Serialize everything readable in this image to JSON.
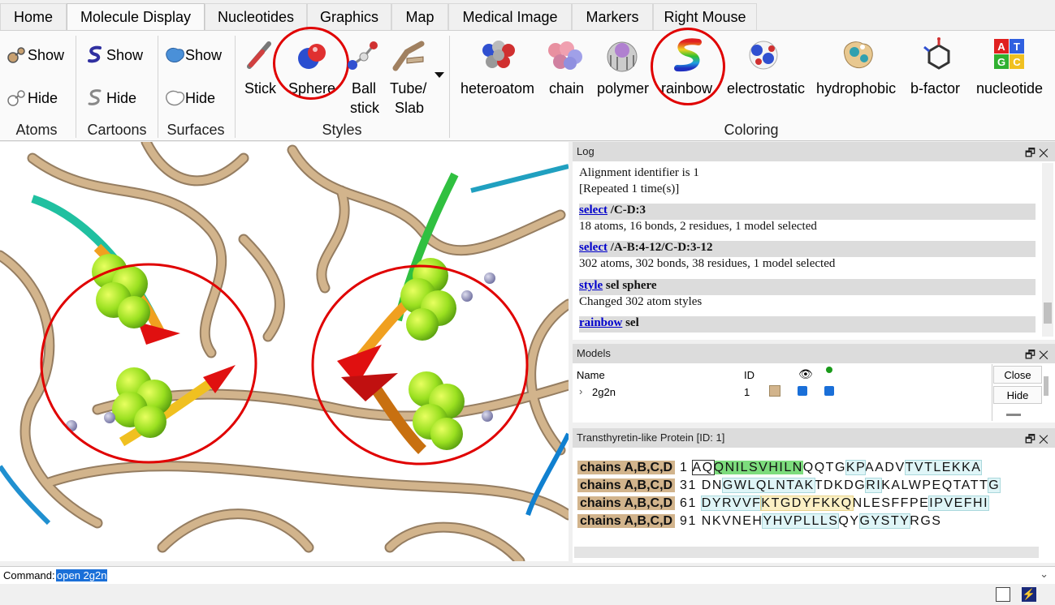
{
  "tabs": [
    "Home",
    "Molecule Display",
    "Nucleotides",
    "Graphics",
    "Map",
    "Medical Image",
    "Markers",
    "Right Mouse"
  ],
  "ribbon": {
    "atoms": {
      "show": "Show",
      "hide": "Hide",
      "label": "Atoms"
    },
    "cartoons": {
      "show": "Show",
      "hide": "Hide",
      "label": "Cartoons"
    },
    "surfaces": {
      "show": "Show",
      "hide": "Hide",
      "label": "Surfaces"
    },
    "styles": {
      "label": "Styles",
      "stick": "Stick",
      "sphere": "Sphere",
      "ball1": "Ball",
      "ball2": "stick",
      "tube1": "Tube/",
      "tube2": "Slab"
    },
    "coloring": {
      "label": "Coloring",
      "items": [
        "heteroatom",
        "chain",
        "polymer",
        "rainbow",
        "electrostatic",
        "hydrophobic",
        "b-factor",
        "nucleotide"
      ]
    }
  },
  "log": {
    "title": "Log",
    "lines": [
      "Alignment identifier is 1",
      "[Repeated 1 time(s)]"
    ],
    "cmd1": {
      "link": "select",
      "rest": " /C-D:3"
    },
    "out1": "18 atoms, 16 bonds, 2 residues, 1 model selected",
    "cmd2": {
      "link": "select",
      "rest": " /A-B:4-12/C-D:3-12"
    },
    "out2": "302 atoms, 302 bonds, 38 residues, 1 model selected",
    "cmd3": {
      "link": "style",
      "rest": " sel sphere"
    },
    "out3": "Changed 302 atom styles",
    "cmd4": {
      "link": "rainbow",
      "rest": " sel"
    }
  },
  "models": {
    "title": "Models",
    "col_name": "Name",
    "col_id": "ID",
    "row_name": "2g2n",
    "row_id": "1",
    "btn_close": "Close",
    "btn_hide": "Hide"
  },
  "sequence": {
    "title": "Transthyretin-like Protein [ID: 1]",
    "chain_label": "chains A,B,C,D",
    "nums": [
      "1",
      "31",
      "61",
      "91"
    ]
  },
  "command": {
    "label": "Command:",
    "value": "open 2g2n"
  },
  "colors": {
    "accent_red": "#e00000",
    "tan": "#d2b48c",
    "link": "#0000cc"
  }
}
